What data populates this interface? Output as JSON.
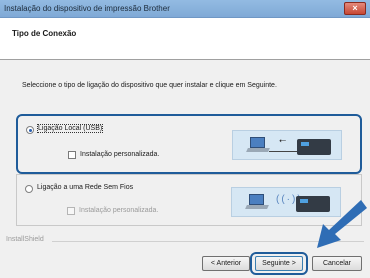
{
  "window": {
    "title": "Instalação do dispositivo de impressão Brother",
    "close_label": "×"
  },
  "header": {
    "title": "Tipo de Conexão"
  },
  "instruction": "Seleccione o tipo de ligação do dispositivo que quer instalar e clique em Seguinte.",
  "options": [
    {
      "label": "Ligação Local (USB)",
      "selected": true,
      "custom_label": "Instalação personalizada.",
      "custom_enabled": true,
      "icon": "usb-connection-illustration"
    },
    {
      "label": "Ligação a uma Rede Sem Fios",
      "selected": false,
      "custom_label": "Instalação personalizada.",
      "custom_enabled": false,
      "icon": "wireless-connection-illustration"
    }
  ],
  "usb_symbol": "⭠",
  "wifi_symbol": "((·))",
  "footer": {
    "brand": "InstallShield"
  },
  "buttons": {
    "back": "< Anterior",
    "next": "Seguinte >",
    "cancel": "Cancelar"
  },
  "colors": {
    "highlight": "#1f5c9a",
    "arrow": "#2f6db5"
  }
}
